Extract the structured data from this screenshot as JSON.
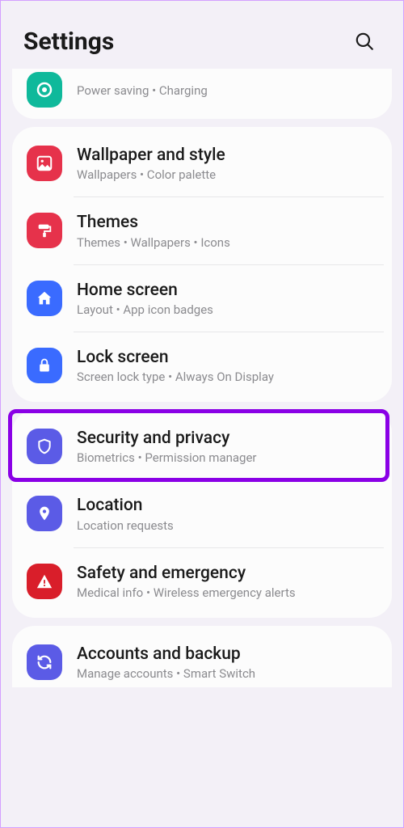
{
  "header": {
    "title": "Settings"
  },
  "colors": {
    "battery": "#0fb99b",
    "wallpaper": "#e6324b",
    "themes": "#e6324b",
    "home": "#3a6bff",
    "lock": "#3a6bff",
    "security": "#5b5be6",
    "location": "#5b5be6",
    "safety": "#d91e2a",
    "accounts": "#5b5be6"
  },
  "group0": {
    "battery": {
      "sub": "Power saving  •  Charging"
    }
  },
  "group1": {
    "wallpaper": {
      "title": "Wallpaper and style",
      "sub": "Wallpapers  •  Color palette"
    },
    "themes": {
      "title": "Themes",
      "sub": "Themes  •  Wallpapers  •  Icons"
    },
    "home": {
      "title": "Home screen",
      "sub": "Layout  •  App icon badges"
    },
    "lock": {
      "title": "Lock screen",
      "sub": "Screen lock type  •  Always On Display"
    }
  },
  "group2": {
    "security": {
      "title": "Security and privacy",
      "sub": "Biometrics  •  Permission manager"
    },
    "location": {
      "title": "Location",
      "sub": "Location requests"
    },
    "safety": {
      "title": "Safety and emergency",
      "sub": "Medical info  •  Wireless emergency alerts"
    }
  },
  "group3": {
    "accounts": {
      "title": "Accounts and backup",
      "sub": "Manage accounts  •  Smart Switch"
    }
  }
}
